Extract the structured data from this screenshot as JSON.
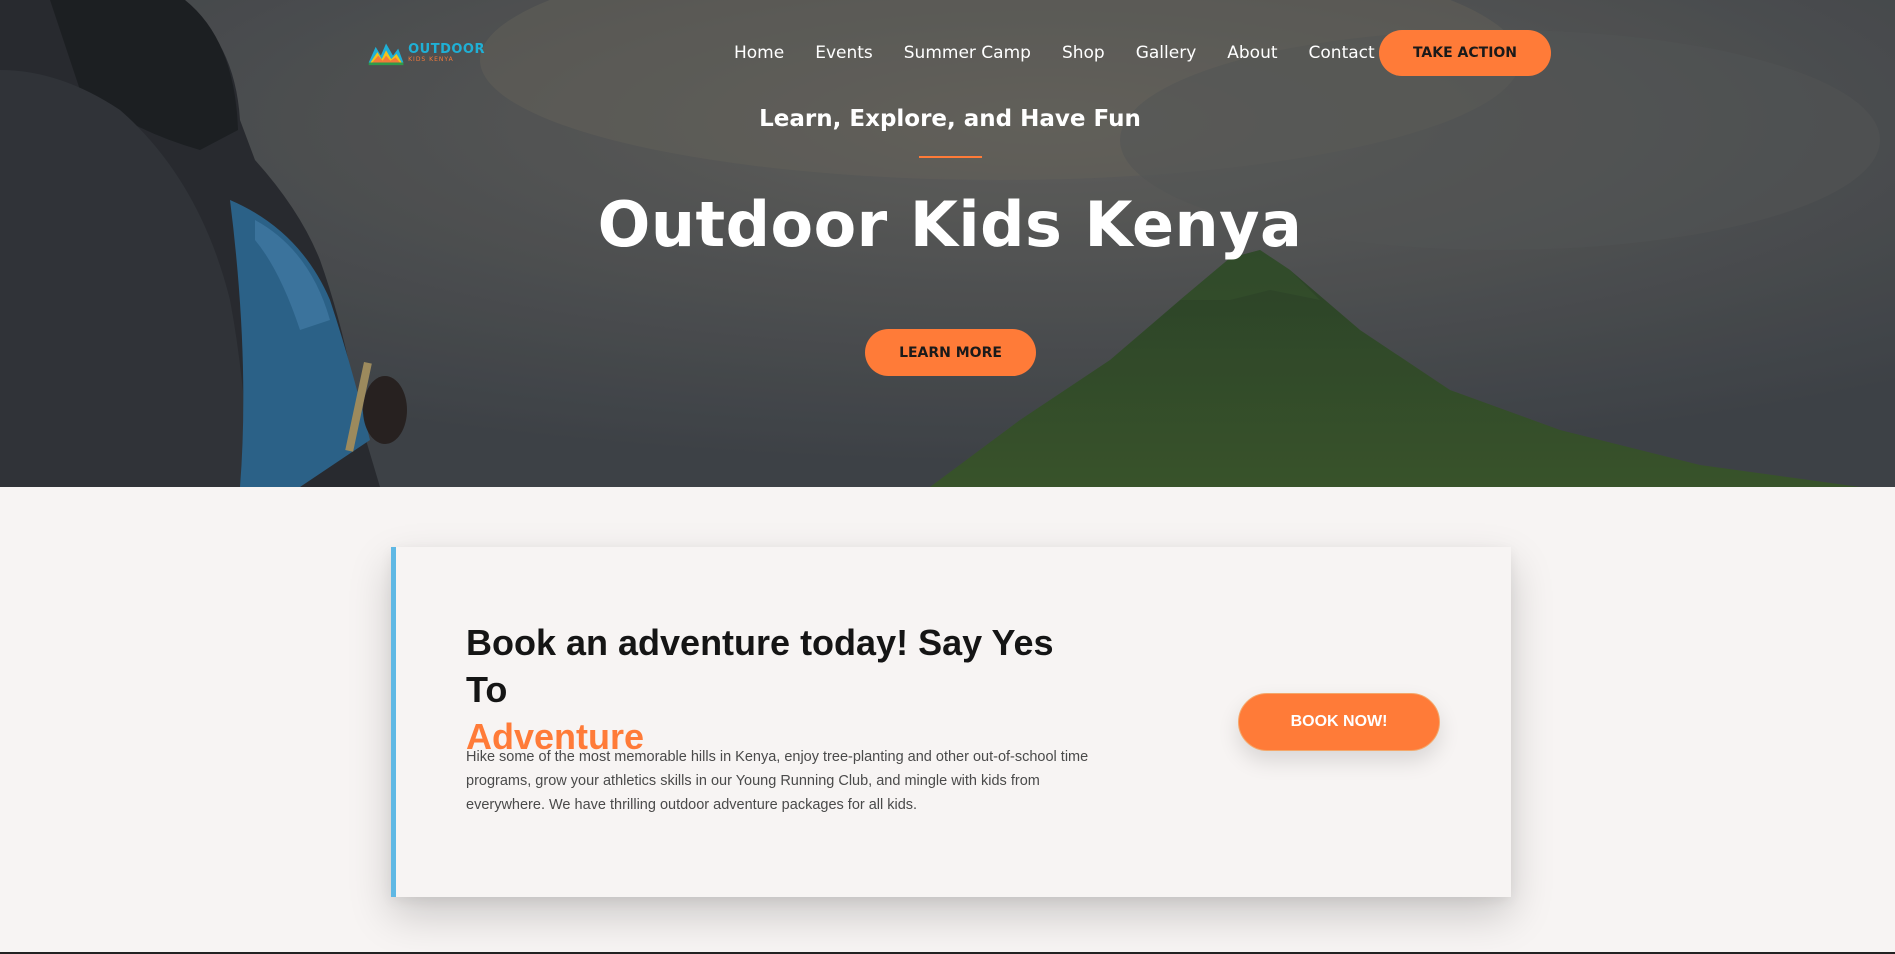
{
  "header": {
    "logo": {
      "main": "OUTDOOR",
      "sub": "KIDS KENYA"
    },
    "nav": [
      "Home",
      "Events",
      "Summer Camp",
      "Shop",
      "Gallery",
      "About",
      "Contact"
    ],
    "cta_label": "TAKE ACTION"
  },
  "hero": {
    "tagline": "Learn, Explore, and Have Fun",
    "title": "Outdoor Kids Kenya",
    "button_label": "LEARN MORE"
  },
  "booking": {
    "heading": "Book an adventure today! Say Yes To",
    "heading_accent": "Adventure",
    "body": "Hike some of the most memorable hills in Kenya, enjoy tree-planting and other out-of-school time programs, grow your athletics skills in our Young Running Club, and mingle with kids from everywhere. We have thrilling outdoor adventure packages for all kids.",
    "button_label": "BOOK NOW!"
  },
  "colors": {
    "accent": "#ff7b38",
    "card_border": "#5fb8e4",
    "logo_blue": "#1fb0d6"
  },
  "icons": [
    "outdoor-kids-logo-icon"
  ]
}
